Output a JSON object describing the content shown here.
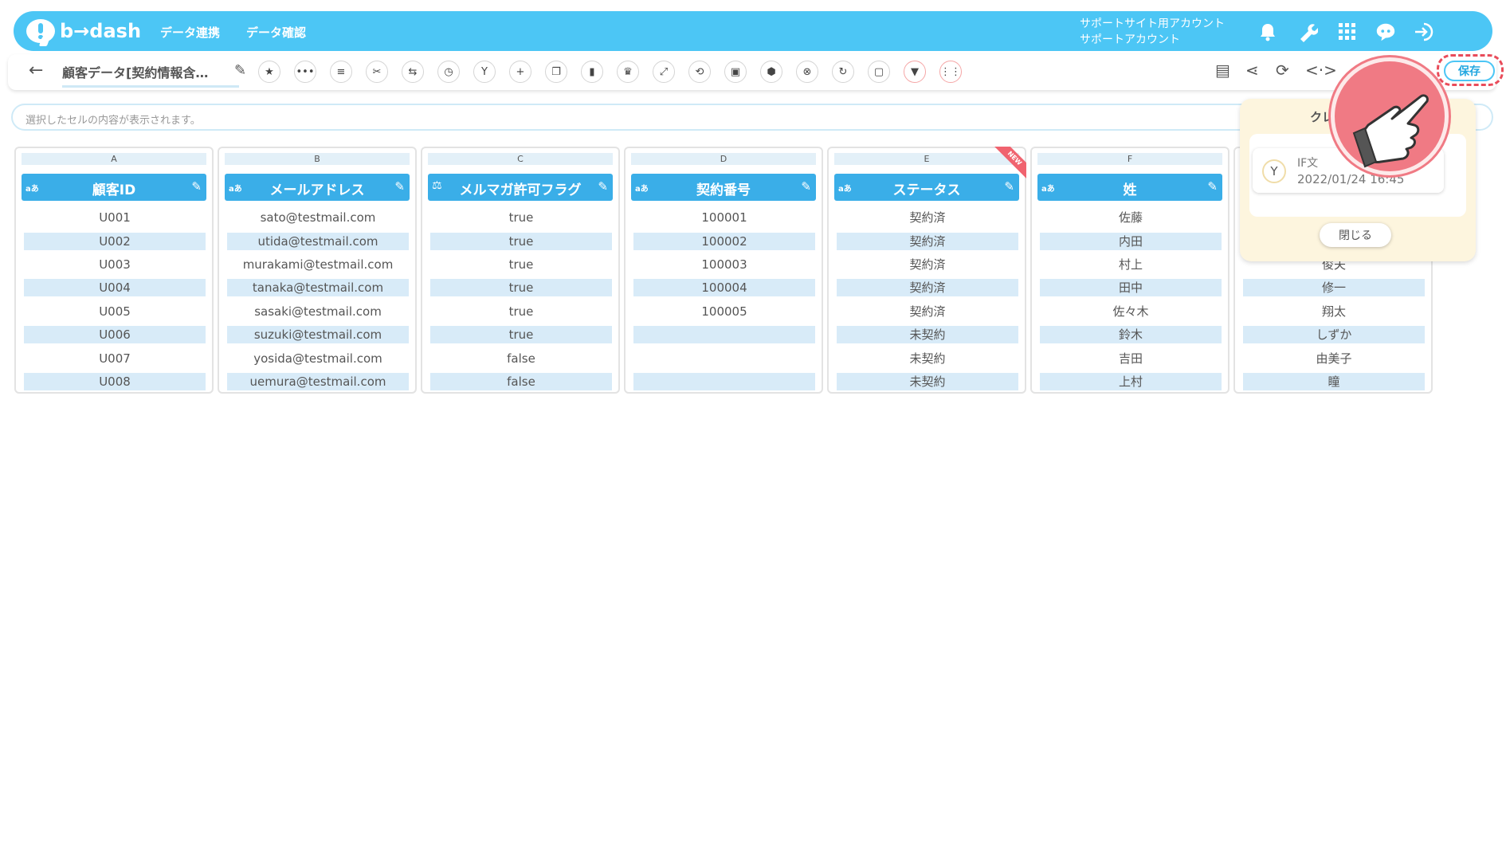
{
  "app": {
    "logo_text": "b→dash",
    "nav": [
      "データ連携",
      "データ確認"
    ],
    "account_line1": "サポートサイト用アカウント",
    "account_line2": "サポートアカウント"
  },
  "toolbar": {
    "back": "←",
    "title": "顧客データ[契約情報含…",
    "save_label": "保存"
  },
  "cellbar": {
    "placeholder": "選択したセルの内容が表示されます。"
  },
  "columns": [
    {
      "letter": "A",
      "type": "aあ",
      "name": "顧客ID",
      "cells": [
        "U001",
        "U002",
        "U003",
        "U004",
        "U005",
        "U006",
        "U007",
        "U008"
      ]
    },
    {
      "letter": "B",
      "type": "aあ",
      "name": "メールアドレス",
      "cells": [
        "sato@testmail.com",
        "utida@testmail.com",
        "murakami@testmail.com",
        "tanaka@testmail.com",
        "sasaki@testmail.com",
        "suzuki@testmail.com",
        "yosida@testmail.com",
        "uemura@testmail.com"
      ]
    },
    {
      "letter": "C",
      "type": "",
      "name": "メルマガ許可フラグ",
      "cells": [
        "true",
        "true",
        "true",
        "true",
        "true",
        "true",
        "false",
        "false"
      ]
    },
    {
      "letter": "D",
      "type": "aあ",
      "name": "契約番号",
      "cells": [
        "100001",
        "100002",
        "100003",
        "100004",
        "100005",
        "",
        "",
        ""
      ]
    },
    {
      "letter": "E",
      "type": "aあ",
      "name": "ステータス",
      "badge": "NEW",
      "cells": [
        "契約済",
        "契約済",
        "契約済",
        "契約済",
        "契約済",
        "未契約",
        "未契約",
        "未契約"
      ]
    },
    {
      "letter": "F",
      "type": "aあ",
      "name": "姓",
      "cells": [
        "佐藤",
        "内田",
        "村上",
        "田中",
        "佐々木",
        "鈴木",
        "吉田",
        "上村"
      ]
    },
    {
      "letter": "",
      "type": "",
      "name": "",
      "cells": [
        "",
        "",
        "俊夫",
        "修一",
        "翔太",
        "しずか",
        "由美子",
        "瞳"
      ]
    }
  ],
  "popup": {
    "title": "クレ",
    "item_name": "IF文",
    "item_date": "2022/01/24 16:45",
    "close_label": "閉じる"
  }
}
